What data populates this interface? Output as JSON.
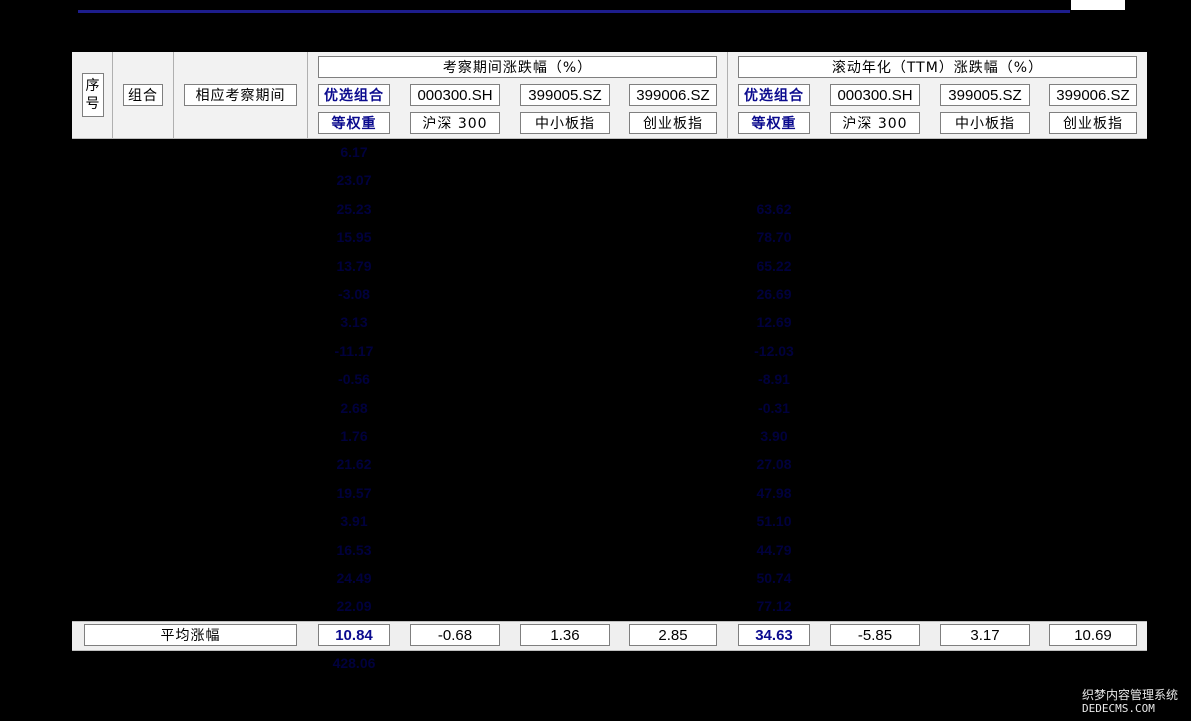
{
  "header": {
    "seq": "序\n号",
    "combo": "组合",
    "period": "相应考察期间",
    "group1": "考察期间涨跌幅（%）",
    "group2": "滚动年化（TTM）涨跌幅（%）",
    "codes1": [
      "优选组合",
      "000300.SH",
      "399005.SZ",
      "399006.SZ"
    ],
    "names1": [
      "等权重",
      "沪深 300",
      "中小板指",
      "创业板指"
    ],
    "codes2": [
      "优选组合",
      "000300.SH",
      "399005.SZ",
      "399006.SZ"
    ],
    "names2": [
      "等权重",
      "沪深 300",
      "中小板指",
      "创业板指"
    ]
  },
  "rows": {
    "col1": [
      "6.17",
      "23.07",
      "25.23",
      "15.95",
      "13.79",
      "-3.08",
      "3.13",
      "-11.17",
      "-0.56",
      "2.68",
      "1.76",
      "21.62",
      "19.57",
      "3.91",
      "16.53",
      "24.49",
      "22.09"
    ],
    "col2": [
      "",
      "",
      "63.62",
      "78.70",
      "65.22",
      "26.69",
      "12.69",
      "-12.03",
      "-8.91",
      "-0.31",
      "3.90",
      "27.08",
      "47.98",
      "51.10",
      "44.79",
      "50.74",
      "77.12"
    ]
  },
  "average": {
    "label": "平均涨幅",
    "values": [
      "10.84",
      "-0.68",
      "1.36",
      "2.85",
      "34.63",
      "-5.85",
      "3.17",
      "10.69"
    ]
  },
  "footer_value": "428.06",
  "watermark": {
    "line1": "织梦内容管理系统",
    "line2": "DEDECMS.COM"
  },
  "colors": {
    "accent_blue": "#0b0b8e",
    "background": "#000000",
    "header_bg": "#f2f2f2"
  }
}
